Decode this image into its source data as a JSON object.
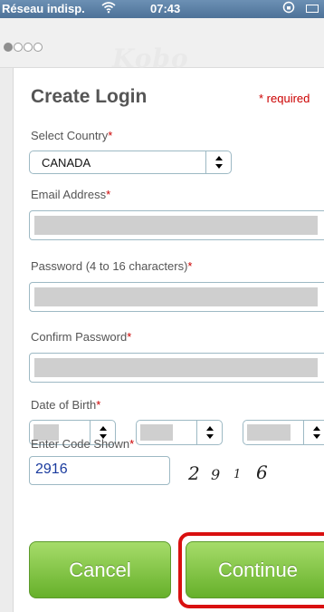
{
  "status_bar": {
    "carrier": "Réseau indisp.",
    "time": "07:43"
  },
  "header": {
    "brand": "Kobo",
    "step_dots": [
      true,
      false,
      false,
      false
    ]
  },
  "form": {
    "title": "Create Login",
    "required_note": "* required",
    "country": {
      "label": "Select Country",
      "star": "*",
      "value": "CANADA"
    },
    "email": {
      "label": "Email Address",
      "star": "*"
    },
    "password": {
      "label": "Password (4 to 16 characters)",
      "star": "*"
    },
    "confirm_password": {
      "label": "Confirm Password",
      "star": "*"
    },
    "dob": {
      "label": "Date of Birth",
      "star": "*"
    },
    "code": {
      "label": "Enter Code Shown",
      "star": "*",
      "value": "2916",
      "captcha": [
        "2",
        "9",
        "1",
        "6"
      ]
    }
  },
  "buttons": {
    "cancel": "Cancel",
    "continue": "Continue"
  },
  "colors": {
    "status_bar": "#5a7ea3",
    "required": "#cc0000",
    "button_green": "#7cc23c",
    "highlight": "#d91010"
  },
  "icons": [
    "wifi-icon",
    "lock-rotation-icon",
    "battery-icon",
    "select-arrow-icon"
  ]
}
